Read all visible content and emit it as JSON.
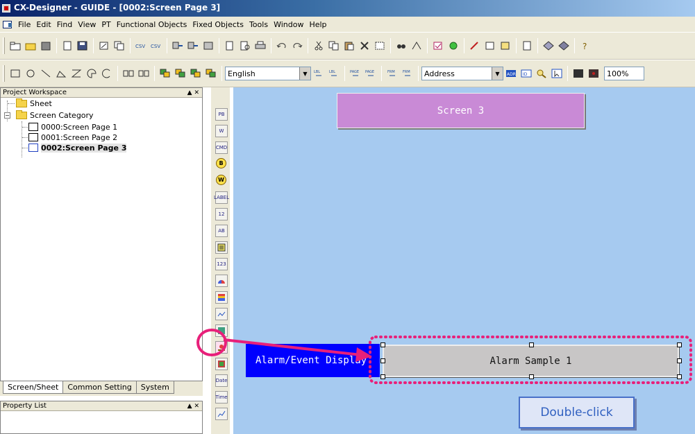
{
  "window": {
    "title": "CX-Designer - GUIDE - [0002:Screen Page 3]"
  },
  "menu": [
    "File",
    "Edit",
    "Find",
    "View",
    "PT",
    "Functional Objects",
    "Fixed Objects",
    "Tools",
    "Window",
    "Help"
  ],
  "toolbar": {
    "language": "English",
    "address": "Address",
    "zoom": "100%"
  },
  "workspace": {
    "header": "Project Workspace",
    "tree": {
      "sheet": "Sheet",
      "screen_category": "Screen Category",
      "pages": [
        "0000:Screen Page 1",
        "0001:Screen Page 2",
        "0002:Screen Page 3"
      ]
    },
    "tabs": [
      "Screen/Sheet",
      "Common Setting",
      "System"
    ]
  },
  "property_list": {
    "header": "Property List"
  },
  "palette": {
    "items": [
      "PB",
      "W",
      "CMD",
      "B",
      "W",
      "LABEL",
      "12",
      "AB",
      "",
      "123",
      "",
      "",
      "",
      "",
      "",
      "",
      "Date",
      "Time",
      ""
    ]
  },
  "canvas": {
    "screen_title": "Screen 3",
    "alarm_label": "Alarm/Event Display",
    "alarm_box": "Alarm Sample 1"
  },
  "annotation": {
    "callout": "Double-click",
    "highlight_color": "#e8207a"
  }
}
